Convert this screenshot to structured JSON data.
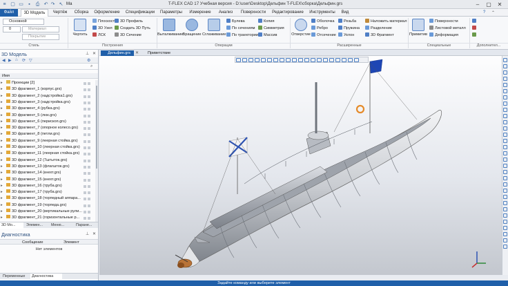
{
  "titlebar": {
    "title": "T-FLEX CAD 17 Учебная версия - D:\\user\\Desktop\\Дельфин T-FLEX\\сборка\\Дельфин.grs",
    "qa_label": "Ма"
  },
  "tabs": [
    {
      "label": "Файл"
    },
    {
      "label": "3D Модель"
    },
    {
      "label": "Чертёж"
    },
    {
      "label": "Сборка"
    },
    {
      "label": "Оформление"
    },
    {
      "label": "Спецификации"
    },
    {
      "label": "Параметры"
    },
    {
      "label": "Измерение"
    },
    {
      "label": "Анализ"
    },
    {
      "label": "Поверхности"
    },
    {
      "label": "Редактирование"
    },
    {
      "label": "Инструменты"
    },
    {
      "label": "Вид"
    }
  ],
  "ribbon": {
    "style": {
      "layer": "Основной",
      "level": "0",
      "material": "Материал",
      "cover": "Покрытие",
      "group": "Стиль"
    },
    "construct": {
      "draw": "Чертить",
      "plane": "Плоскость",
      "node3d": "3D Узел",
      "lsk": "ЛСК",
      "profile3d": "3D Профиль",
      "path3d": "Создать 3D Путь",
      "section3d": "3D Сечение",
      "group": "Построения"
    },
    "ops": {
      "extrude": "Выталкивание",
      "rotate": "Вращение",
      "loft": "Сглаживание",
      "boolean": "Булева",
      "by_sections": "По сечениям",
      "by_path": "По траектории",
      "copy": "Копия",
      "symmetry": "Симметрия",
      "array": "Массив",
      "group": "Операции"
    },
    "ext": {
      "hole": "Отверстие",
      "shell": "Оболочка",
      "rib": "Ребро",
      "cut": "Отсечение",
      "thread": "Резьба",
      "spring": "Пружина",
      "slope": "Уклон",
      "apply_mat": "Наложить материал",
      "split": "Разделение",
      "fragment3d": "3D Фрагмент",
      "group": "Расширенные"
    },
    "spec": {
      "primitives": "Примитив",
      "surfaces": "Поверхности",
      "sheet": "Листовой металл",
      "deform": "Деформация",
      "group": "Специальные"
    },
    "extra": {
      "group": "Дополнител..."
    }
  },
  "doc_tabs": [
    {
      "label": "Дельфин.grs",
      "active": true
    },
    {
      "label": "Приветствие",
      "active": false
    }
  ],
  "model_panel": {
    "title": "3D Модель",
    "column_name": "Имя",
    "items": [
      "Проекции [2]",
      "3D фрагмент_1 (корпус.grs)",
      "3D фрагмент_2 (надстройка1.grs)",
      "3D фрагмент_3 (надстройка.grs)",
      "3D фрагмент_4 (рубка.grs)",
      "3D фрагмент_5 (люк.grs)",
      "3D фрагмент_6 (перископ.grs)",
      "3D фрагмент_7 (опорное колесо.grs)",
      "3D фрагмент_8 (петли.grs)",
      "3D фрагмент_9 (леерная стойка.grs)",
      "3D фрагмент_10 (леерная стойка.grs)",
      "3D фрагмент_11 (леерная стойка.grs)",
      "3D фрагмент_12 (7штыток.grs)",
      "3D фрагмент_13 (флагшток.grs)",
      "3D фрагмент_14 (кнехт.grs)",
      "3D фрагмент_15 (кнехт.grs)",
      "3D фрагмент_16 (труба.grs)",
      "3D фрагмент_17 (труба.grs)",
      "3D фрагмент_18 (торпедный аппара...",
      "3D фрагмент_19 (торпеда.grs)",
      "3D фрагмент_20 (вертикальные рули...",
      "3D фрагмент_21 (горизонтальные р..."
    ]
  },
  "panel_tabs": [
    "3D Мо...",
    "Элемен...",
    "Меню...",
    "Паране..."
  ],
  "diag_panel": {
    "title": "Диагностика",
    "col_message": "Сообщение",
    "col_element": "Элемент",
    "empty": "Нет элементов"
  },
  "bottom_tabs": [
    "Переменные",
    "Диагностика"
  ],
  "status": "Задайте команду или выберите элемент",
  "colors": {
    "accent": "#1f5fa9",
    "flag_blue": "#1e46b4",
    "lifebuoy": "#e58b2a",
    "propeller": "#b87337"
  }
}
